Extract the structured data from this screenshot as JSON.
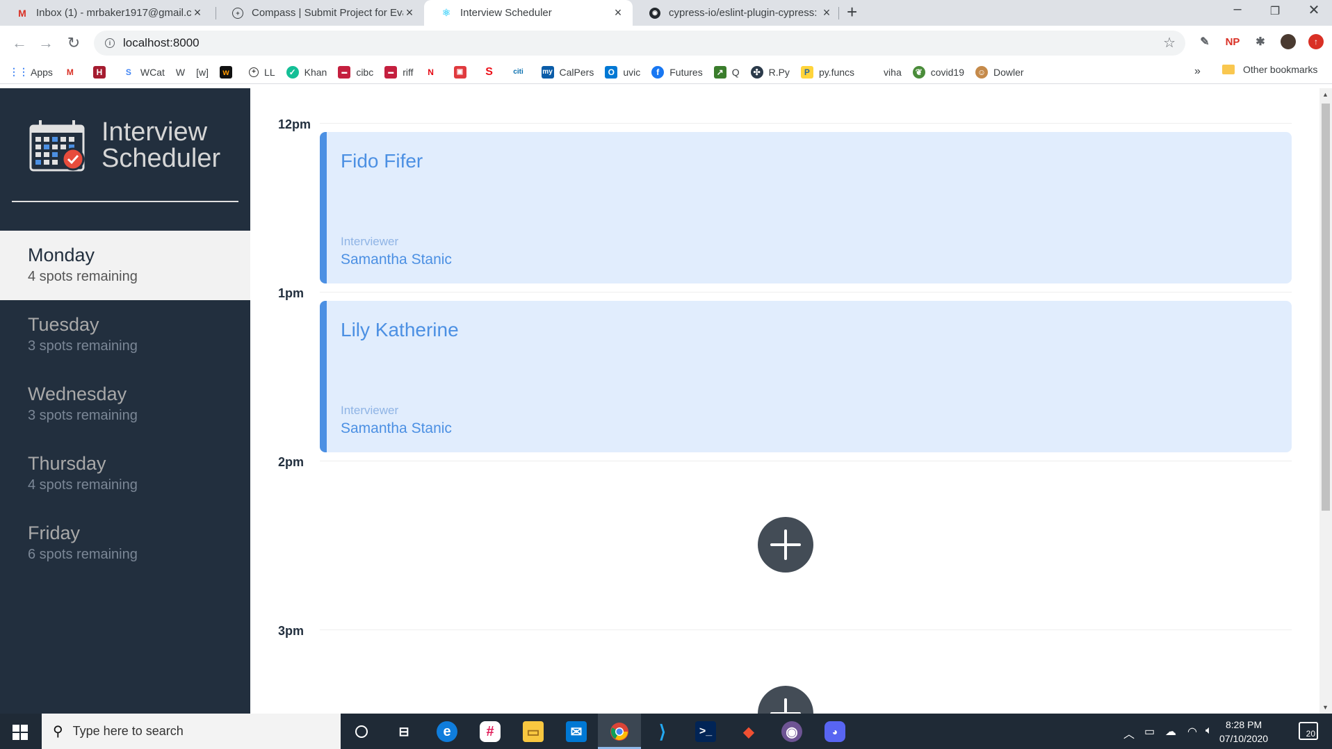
{
  "browser": {
    "tabs": [
      {
        "title": "Inbox (1) - mrbaker1917@gmail.c",
        "icon": "gmail-icon"
      },
      {
        "title": "Compass | Submit Project for Eva",
        "icon": "compass-icon"
      },
      {
        "title": "Interview Scheduler",
        "icon": "react-icon"
      },
      {
        "title": "cypress-io/eslint-plugin-cypress:",
        "icon": "github-icon"
      }
    ],
    "url": "localhost:8000",
    "bookmarks": [
      "Apps",
      "",
      "",
      "WCat",
      "W",
      "[w]",
      "",
      "LL",
      "Khan",
      "cibc",
      "riff",
      "",
      "",
      "",
      "",
      "CalPers",
      "uvic",
      "Futures",
      "Q",
      "R.Py",
      "py.funcs",
      "viha",
      "covid19",
      "Dowler"
    ],
    "more_bookmarks": "»",
    "other_bookmarks": "Other bookmarks"
  },
  "app": {
    "logo_line1": "Interview",
    "logo_line2": "Scheduler",
    "days": [
      {
        "name": "Monday",
        "spots": "4 spots remaining",
        "selected": true
      },
      {
        "name": "Tuesday",
        "spots": "3 spots remaining",
        "selected": false
      },
      {
        "name": "Wednesday",
        "spots": "3 spots remaining",
        "selected": false
      },
      {
        "name": "Thursday",
        "spots": "4 spots remaining",
        "selected": false
      },
      {
        "name": "Friday",
        "spots": "6 spots remaining",
        "selected": false
      }
    ],
    "times": [
      "12pm",
      "1pm",
      "2pm",
      "3pm"
    ],
    "appointments": [
      {
        "student": "Fido Fifer",
        "interviewer_label": "Interviewer",
        "interviewer": "Samantha Stanic"
      },
      {
        "student": "Lily Katherine",
        "interviewer_label": "Interviewer",
        "interviewer": "Samantha Stanic"
      }
    ]
  },
  "taskbar": {
    "search_placeholder": "Type here to search",
    "time": "8:28 PM",
    "date": "07/10/2020",
    "notifications": "20"
  }
}
